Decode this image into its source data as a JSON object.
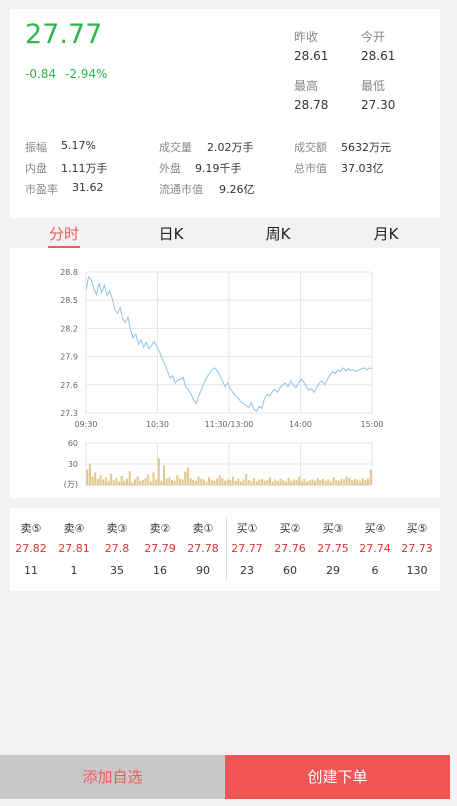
{
  "quote": {
    "price": "27.77",
    "change": "-0.84",
    "change_pct": "-2.94%",
    "prev_close_label": "昨收",
    "prev_close": "28.61",
    "open_label": "今开",
    "open": "28.61",
    "high_label": "最高",
    "high": "28.78",
    "low_label": "最低",
    "low": "27.30"
  },
  "stats": [
    [
      {
        "label": "振幅",
        "value": "5.17%"
      },
      {
        "label": "成交量",
        "value": "2.02万手"
      },
      {
        "label": "成交额",
        "value": "5632万元"
      }
    ],
    [
      {
        "label": "内盘",
        "value": "1.11万手"
      },
      {
        "label": "外盘",
        "value": "9.19千手"
      },
      {
        "label": "总市值",
        "value": "37.03亿"
      }
    ],
    [
      {
        "label": "市盈率",
        "value": "31.62"
      },
      {
        "label": "流通市值",
        "value": "9.26亿"
      }
    ]
  ],
  "tabs": [
    "分时",
    "日K",
    "周K",
    "月K"
  ],
  "chart_data": [
    {
      "type": "line",
      "x_ticks": [
        "09:30",
        "10:30",
        "11:30/13:00",
        "14:00",
        "15:00"
      ],
      "y_ticks": [
        "28.8",
        "28.5",
        "28.2",
        "27.9",
        "27.6",
        "27.3"
      ],
      "ylim": [
        27.3,
        28.8
      ],
      "series": [
        {
          "values": [
            28.61,
            28.75,
            28.72,
            28.62,
            28.56,
            28.68,
            28.58,
            28.66,
            28.55,
            28.6,
            28.52,
            28.4,
            28.36,
            28.42,
            28.3,
            28.26,
            28.32,
            28.18,
            28.1,
            28.14,
            28.03,
            28.08,
            28.0,
            28.05,
            27.98,
            28.02,
            28.06,
            28.01,
            27.95,
            27.88,
            27.82,
            27.75,
            27.67,
            27.7,
            27.62,
            27.65,
            27.66,
            27.68,
            27.58,
            27.55,
            27.5,
            27.44,
            27.4,
            27.48,
            27.55,
            27.62,
            27.68,
            27.72,
            27.76,
            27.78,
            27.75,
            27.7,
            27.64,
            27.58,
            27.62,
            27.56,
            27.52,
            27.48,
            27.46,
            27.42,
            27.4,
            27.38,
            27.36,
            27.41,
            27.34,
            27.32,
            27.37,
            27.35,
            27.45,
            27.5,
            27.48,
            27.53,
            27.55,
            27.52,
            27.57,
            27.6,
            27.62,
            27.58,
            27.64,
            27.6,
            27.57,
            27.62,
            27.66,
            27.63,
            27.58,
            27.54,
            27.56,
            27.52,
            27.58,
            27.62,
            27.64,
            27.6,
            27.66,
            27.7,
            27.74,
            27.72,
            27.76,
            27.74,
            27.78,
            27.75,
            27.77,
            27.75,
            27.76,
            27.74,
            27.76,
            27.77,
            27.78,
            27.76,
            27.78,
            27.77
          ]
        }
      ]
    },
    {
      "type": "bar",
      "y_ticks": [
        "60",
        "30"
      ],
      "ylabel": "(万)",
      "ylim": [
        0,
        60
      ],
      "values": [
        22,
        30,
        12,
        18,
        9,
        14,
        8,
        11,
        6,
        16,
        7,
        10,
        5,
        13,
        6,
        9,
        20,
        4,
        8,
        12,
        6,
        7,
        10,
        15,
        5,
        18,
        8,
        38,
        6,
        28,
        9,
        11,
        7,
        6,
        14,
        9,
        8,
        19,
        25,
        10,
        7,
        6,
        12,
        9,
        8,
        5,
        11,
        7,
        6,
        9,
        14,
        10,
        6,
        8,
        7,
        12,
        6,
        9,
        5,
        8,
        16,
        7,
        6,
        10,
        5,
        8,
        9,
        6,
        7,
        11,
        5,
        8,
        6,
        9,
        7,
        5,
        10,
        6,
        8,
        7,
        12,
        6,
        9,
        5,
        7,
        8,
        6,
        10,
        7,
        9,
        6,
        8,
        5,
        11,
        7,
        6,
        9,
        8,
        12,
        10,
        7,
        9,
        8,
        6,
        10,
        7,
        9,
        22
      ]
    }
  ],
  "order_book": {
    "sell": [
      {
        "label": "卖⑤",
        "price": "27.82",
        "vol": "11"
      },
      {
        "label": "卖④",
        "price": "27.81",
        "vol": "1"
      },
      {
        "label": "卖③",
        "price": "27.8",
        "vol": "35"
      },
      {
        "label": "卖②",
        "price": "27.79",
        "vol": "16"
      },
      {
        "label": "卖①",
        "price": "27.78",
        "vol": "90"
      }
    ],
    "buy": [
      {
        "label": "买①",
        "price": "27.77",
        "vol": "23"
      },
      {
        "label": "买②",
        "price": "27.76",
        "vol": "60"
      },
      {
        "label": "买③",
        "price": "27.75",
        "vol": "29"
      },
      {
        "label": "买④",
        "price": "27.74",
        "vol": "6"
      },
      {
        "label": "买⑤",
        "price": "27.73",
        "vol": "130"
      }
    ]
  },
  "actions": {
    "add_watch": "添加自选",
    "create_order": "创建下单"
  },
  "colors": {
    "up_green": "#2db84d",
    "down_red": "#d93535",
    "accent": "#f05a5a",
    "line": "#8ec3e6",
    "volume": "#e0c88a"
  }
}
